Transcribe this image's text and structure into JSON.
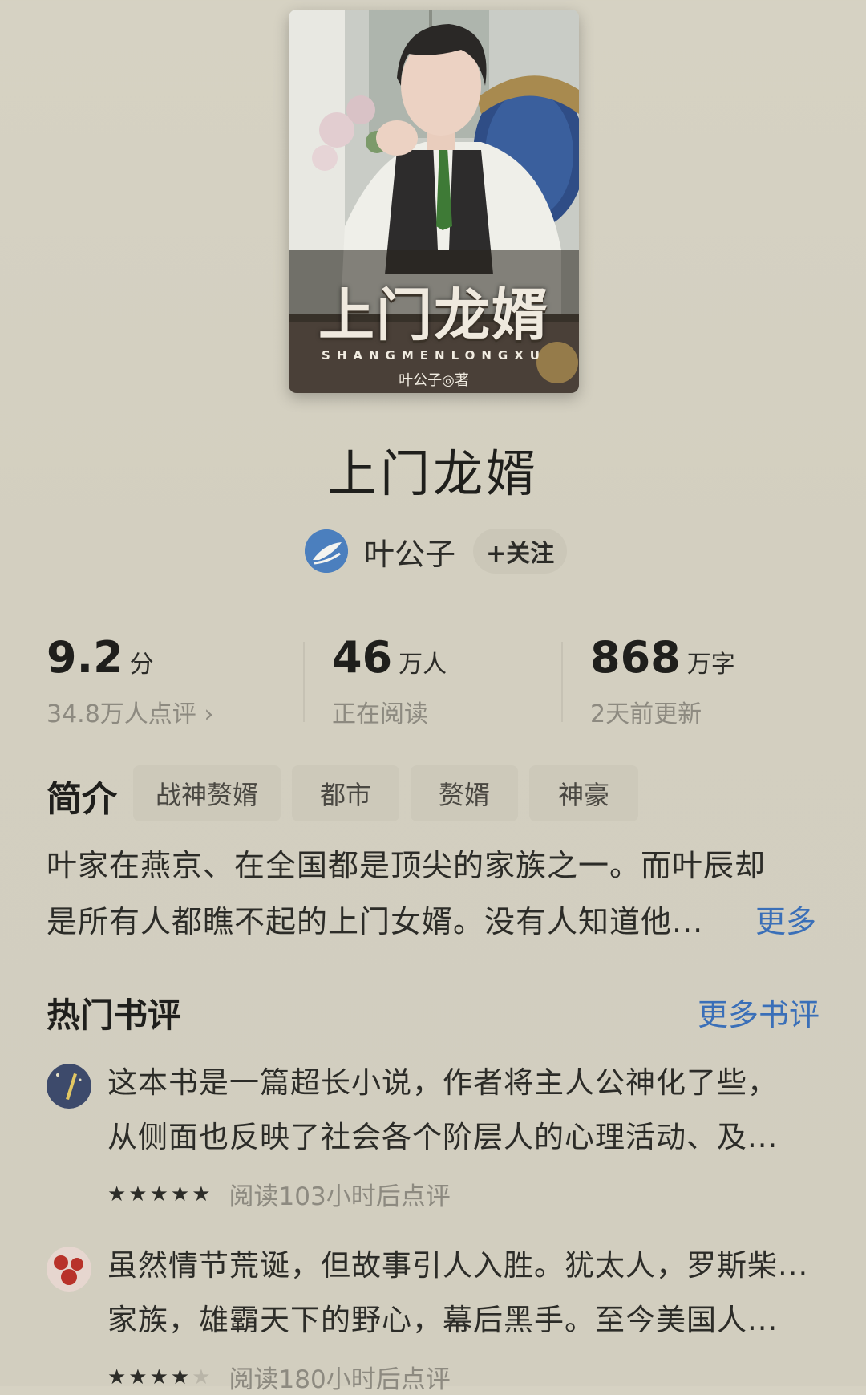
{
  "cover": {
    "title": "上门龙婿",
    "pinyin": "SHANGMENLONGXU",
    "author_line": "叶公子◎著"
  },
  "book": {
    "title": "上门龙婿",
    "author": "叶公子",
    "follow_label": "+关注"
  },
  "stats": [
    {
      "value": "9.2",
      "unit": "分",
      "sub": "34.8万人点评 ›"
    },
    {
      "value": "46",
      "unit": "万人",
      "sub": "正在阅读"
    },
    {
      "value": "868",
      "unit": "万字",
      "sub": "2天前更新"
    }
  ],
  "intro": {
    "label": "简介",
    "tags": [
      "战神赘婿",
      "都市",
      "赘婿",
      "神豪"
    ],
    "text_line1": "叶家在燕京、在全国都是顶尖的家族之一。而叶辰却",
    "text_line2": "是所有人都瞧不起的上门女婿。没有人知道他...",
    "more": "更多"
  },
  "reviews": {
    "heading": "热门书评",
    "more": "更多书评",
    "items": [
      {
        "line1": "这本书是一篇超长小说，作者将主人公神化了些，",
        "line2": "从侧面也反映了社会各个阶层人的心理活动、及...",
        "stars_on": "★★★★★",
        "stars_off": "",
        "rating": 5,
        "meta": "阅读103小时后点评",
        "avatar_color": "#3d4a6b"
      },
      {
        "line1": "虽然情节荒诞，但故事引人入胜。犹太人，罗斯柴...",
        "line2": "家族，雄霸天下的野心，幕后黑手。至今美国人...",
        "stars_on": "★★★★",
        "stars_off": "★",
        "rating": 4,
        "meta": "阅读180小时后点评",
        "avatar_color": "#b8322a"
      }
    ]
  },
  "colors": {
    "background": "#d3cfc0",
    "link": "#3a6fb8",
    "tag_bg": "#cdc9ba"
  }
}
